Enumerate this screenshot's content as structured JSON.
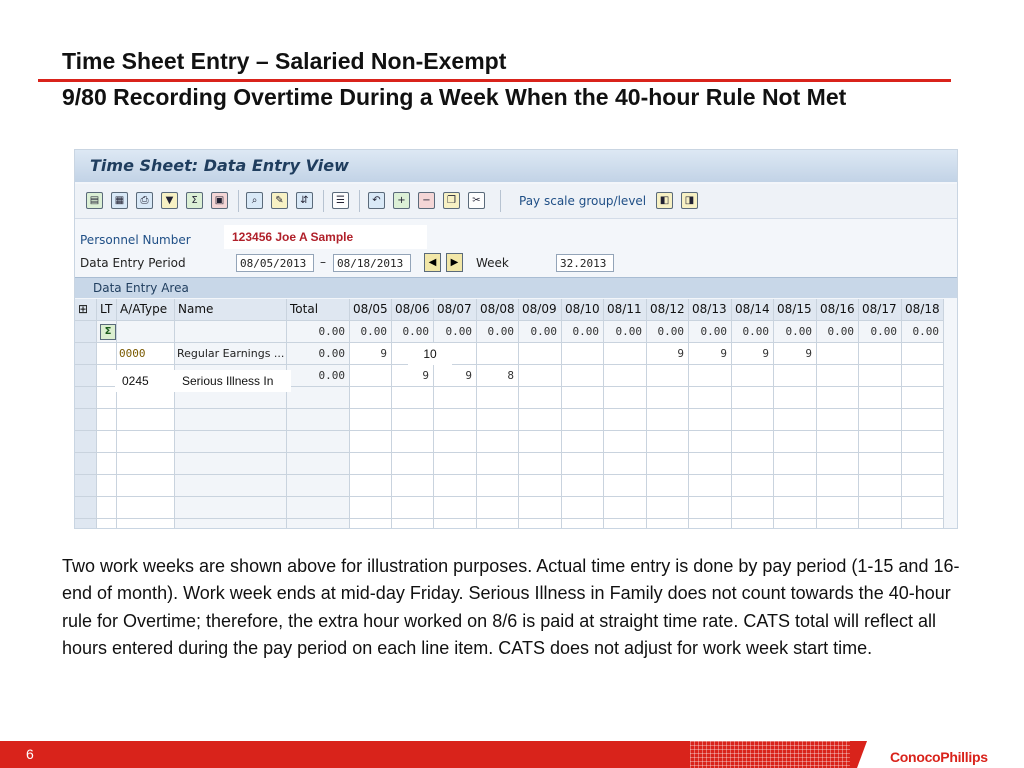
{
  "slide": {
    "title_line1": "Time Sheet Entry – Salaried Non-Exempt",
    "title_line2": "9/80 Recording Overtime During a Week When the 40-hour Rule Not Met",
    "body": "Two work weeks are shown above for illustration purposes. Actual time entry is done by pay period (1-15 and 16-end of month). Work week ends at mid-day Friday.  Serious Illness in Family does not count towards the 40-hour rule for Overtime; therefore, the extra hour worked on 8/6 is paid at straight time rate. CATS total will reflect all hours entered during the pay period on each line item.  CATS does not adjust for work week start time.",
    "page_number": "6",
    "logo_text": "ConocoPhillips",
    "accent_color": "#d9231b"
  },
  "sap": {
    "title": "Time Sheet: Data Entry View",
    "toolbar_text_button": "Pay scale group/level",
    "personnel_number_label": "Personnel Number",
    "personnel_value": "123456 Joe A Sample",
    "period_label": "Data Entry Period",
    "period_from": "08/05/2013",
    "period_sep": "–",
    "period_to": "08/18/2013",
    "week_label": "Week",
    "week_value": "32.2013",
    "area_label": "Data Entry Area",
    "columns": {
      "lt": "LT",
      "atype": "A/AType",
      "name": "Name",
      "total": "Total",
      "dates": [
        "08/05",
        "08/06",
        "08/07",
        "08/08",
        "08/09",
        "08/10",
        "08/11",
        "08/12",
        "08/13",
        "08/14",
        "08/15",
        "08/16",
        "08/17",
        "08/18"
      ]
    },
    "sum_row": {
      "total": "0.00",
      "days": [
        "0.00",
        "0.00",
        "0.00",
        "0.00",
        "0.00",
        "0.00",
        "0.00",
        "0.00",
        "0.00",
        "0.00",
        "0.00",
        "0.00",
        "0.00",
        "0.00"
      ]
    },
    "rows": [
      {
        "atype": "0000",
        "name": "Regular Earnings ...",
        "total": "0.00",
        "days": [
          "9",
          "10",
          "",
          "",
          "",
          "",
          "",
          "9",
          "9",
          "9",
          "9",
          "",
          "",
          ""
        ]
      },
      {
        "atype": "0245",
        "name": "Serious Illness In",
        "total": "0.00",
        "days": [
          "",
          "9",
          "9",
          "8",
          "",
          "",
          "",
          "",
          "",
          "",
          "",
          "",
          "",
          ""
        ]
      }
    ]
  }
}
